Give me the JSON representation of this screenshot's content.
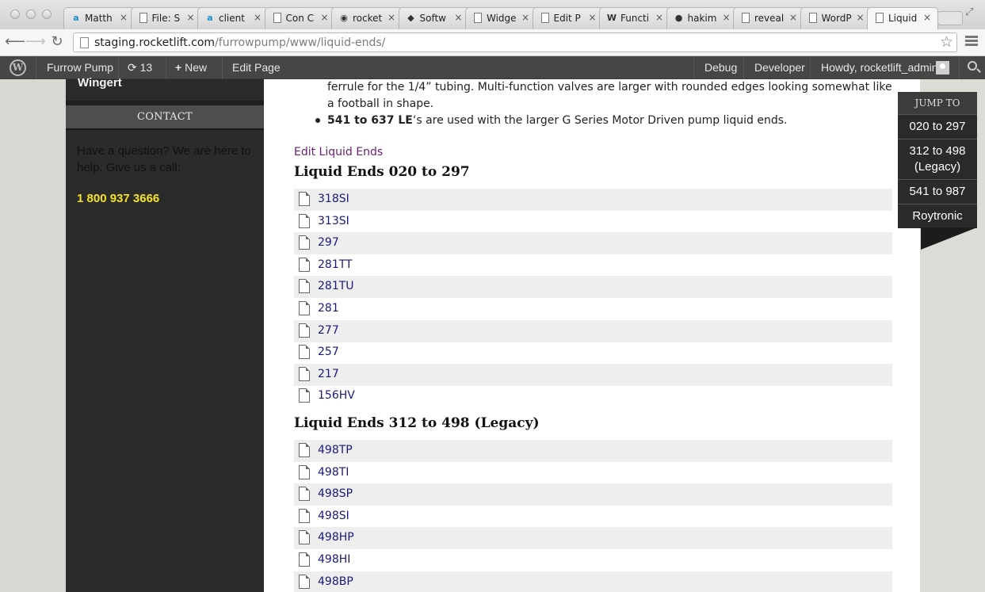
{
  "browser": {
    "tabs": [
      {
        "title": "Matth",
        "icon": "a"
      },
      {
        "title": "File: S",
        "icon": "page"
      },
      {
        "title": "client",
        "icon": "a"
      },
      {
        "title": "Con C",
        "icon": "page"
      },
      {
        "title": "rocket",
        "icon": "shield"
      },
      {
        "title": "Softw",
        "icon": "cube"
      },
      {
        "title": "Widge",
        "icon": "page"
      },
      {
        "title": "Edit P",
        "icon": "page"
      },
      {
        "title": "Functi",
        "icon": "wp"
      },
      {
        "title": "hakim",
        "icon": "github"
      },
      {
        "title": "reveal",
        "icon": "page"
      },
      {
        "title": "WordP",
        "icon": "page"
      },
      {
        "title": "Liquid",
        "icon": "page"
      }
    ],
    "close_glyph": "×",
    "url_host": "staging.rocketlift.com",
    "url_path": "/furrowpump/www/liquid-ends/"
  },
  "adminbar": {
    "site_name": "Furrow Pump",
    "updates_count": "13",
    "new_label": "New",
    "edit_page_label": "Edit Page",
    "debug_label": "Debug",
    "developer_label": "Developer",
    "howdy_label": "Howdy, rocketlift_admin"
  },
  "sidebar": {
    "name": "Wingert",
    "contact_heading": "CONTACT",
    "contact_text": "Have a question? We are here to help. Give us a call:",
    "phone": "1 800 937 3666"
  },
  "content": {
    "bullet1_text": "ferrule for the 1/4” tubing.  Multi-function valves are larger with rounded edges looking somewhat like a football in shape.",
    "bullet2_bold": "541 to 637 LE",
    "bullet2_rest": "‘s are used with the larger G Series Motor Driven pump liquid ends.",
    "edit_link": "Edit Liquid Ends",
    "section1_title": "Liquid Ends 020 to 297",
    "section1_items": [
      "318SI",
      "313SI",
      "297",
      "281TT",
      "281TU",
      "281",
      "277",
      "257",
      "217",
      "156HV"
    ],
    "section2_title": "Liquid Ends 312 to 498 (Legacy)",
    "section2_items": [
      "498TP",
      "498TI",
      "498SP",
      "498SI",
      "498HP",
      "498HI",
      "498BP"
    ]
  },
  "jump_to": {
    "heading": "JUMP TO",
    "items": [
      "020 to 297",
      "312 to 498 (Legacy)",
      "541 to 987",
      "Roytronic"
    ]
  }
}
